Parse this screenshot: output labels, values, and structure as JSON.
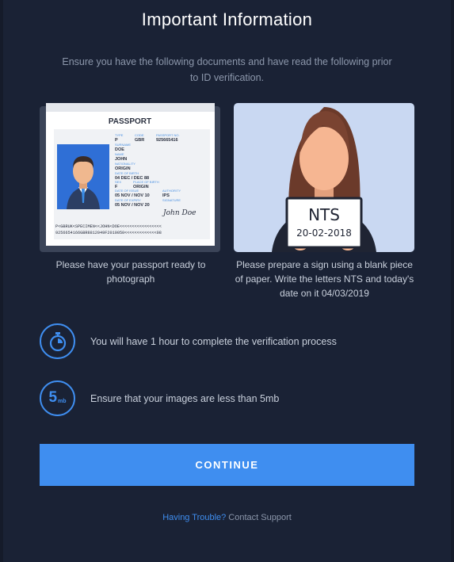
{
  "page": {
    "title": "Important Information",
    "subtitle": "Ensure you have the following documents and have read the following prior to ID verification."
  },
  "passport_card": {
    "doc_title": "PASSPORT",
    "fields": {
      "type_label": "TYPE",
      "type_value": "P",
      "code_label": "CODE",
      "code_value": "GBR",
      "passport_no_label": "PASSPORT NO.",
      "passport_no_value": "925665416",
      "surname_label": "SURNAME",
      "surname_value": "DOE",
      "given_label": "NAME",
      "given_value": "JOHN",
      "nationality_label": "NATIONALITY",
      "nationality_value": "ORIGIN",
      "dob_label": "DATE OF BIRTH",
      "dob_value": "04 DEC / DEC 88",
      "sex_label": "SEX",
      "sex_value": "F",
      "pob_label": "PLACE OF BIRTH",
      "pob_value": "ORIGIN",
      "issue_label": "DATE OF ISSUE",
      "issue_value": "05 NOV / NOV 10",
      "authority_label": "AUTHORITY",
      "authority_value": "IPS",
      "expiry_label": "DATE OF EXPIRY",
      "expiry_value": "05 NOV / NOV 20",
      "signature_label": "SIGNATURE",
      "signature_value": "John Doe"
    },
    "mrz_line1": "P<GBRUK<SPECIMEN<<JOHN<DOE<<<<<<<<<<<<<<<<<",
    "mrz_line2": "9256654166GBR8812049F2010050<<<<<<<<<<<<<08",
    "caption": "Please have your passport ready to photograph"
  },
  "sign_card": {
    "sign_line1": "NTS",
    "sign_line2": "20-02-2018",
    "caption": "Please prepare a sign using a blank piece of paper. Write the letters NTS and today's date on it 04/03/2019"
  },
  "info_rows": [
    {
      "icon": "stopwatch-icon",
      "text": "You will have 1 hour to complete the verification process"
    },
    {
      "icon": "file-size-icon",
      "icon_number": "5",
      "icon_unit": "mb",
      "text": "Ensure that your images are less than 5mb"
    }
  ],
  "continue_label": "CONTINUE",
  "help": {
    "link": "Having Trouble?",
    "text": "Contact Support"
  },
  "colors": {
    "background": "#1a2235",
    "accent": "#3f8ef0",
    "text": "#c9d0dc",
    "muted": "#8c97ab"
  }
}
